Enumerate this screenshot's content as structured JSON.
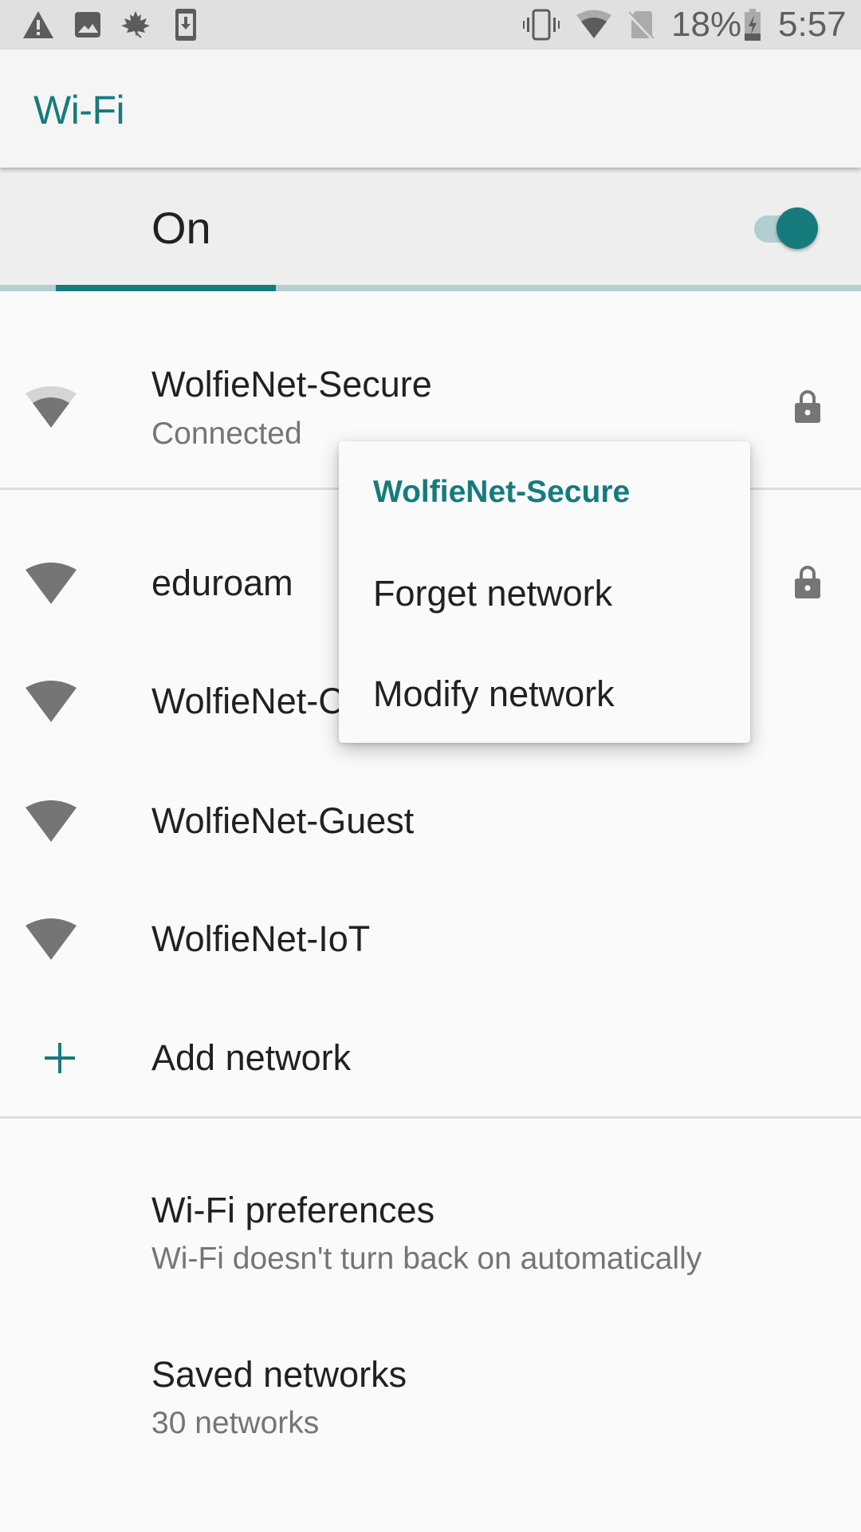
{
  "status_bar": {
    "left_icons": [
      "warning-icon",
      "image-icon",
      "maple-leaf-icon",
      "download-phone-icon"
    ],
    "right_icons": [
      "vibrate-icon",
      "wifi-signal-icon",
      "no-sim-icon",
      "battery-charging-icon"
    ],
    "battery_percent": "18%",
    "time": "5:57"
  },
  "app_bar": {
    "title": "Wi-Fi"
  },
  "master_switch": {
    "label": "On",
    "state": true
  },
  "scan_progress": {
    "indeterminate": true
  },
  "networks": [
    {
      "name": "WolfieNet-Secure",
      "status": "Connected",
      "secured": true,
      "signal": "medium"
    },
    {
      "name": "eduroam",
      "secured": true,
      "signal": "full"
    },
    {
      "name": "WolfieNet-Guest-Registration",
      "visible_text": "WolfieNet-C",
      "secured": false,
      "signal": "full"
    },
    {
      "name": "WolfieNet-Guest",
      "secured": false,
      "signal": "full"
    },
    {
      "name": "WolfieNet-IoT",
      "secured": false,
      "signal": "full"
    }
  ],
  "add_network": {
    "label": "Add network",
    "icon": "plus-icon"
  },
  "preferences": {
    "title": "Wi-Fi preferences",
    "subtitle": "Wi-Fi doesn't turn back on automatically"
  },
  "saved_networks": {
    "title": "Saved networks",
    "subtitle": "30 networks"
  },
  "context_menu": {
    "title": "WolfieNet-Secure",
    "items": [
      {
        "label": "Forget network"
      },
      {
        "label": "Modify network"
      }
    ]
  },
  "colors": {
    "accent": "#177b7e",
    "accent_light": "#b3cfd1",
    "status_bar_bg": "#e0e0e0",
    "icon_gray": "#757575"
  }
}
